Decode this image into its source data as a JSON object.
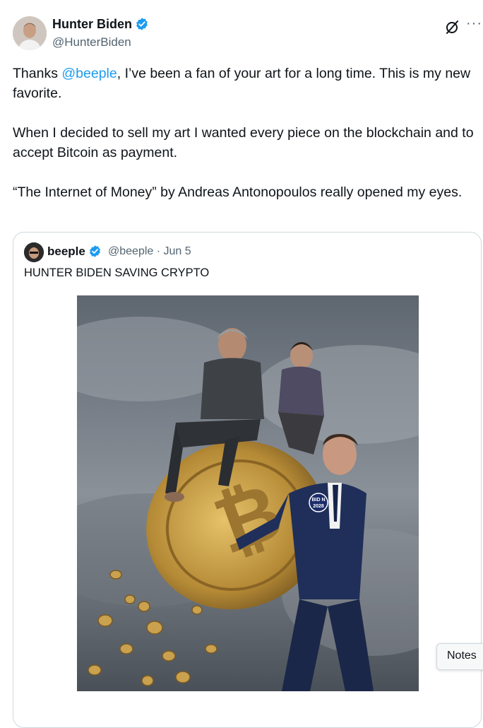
{
  "author": {
    "name": "Hunter Biden",
    "handle": "@HunterBiden"
  },
  "tweet": {
    "p1_before": "Thanks ",
    "p1_mention": "@beeple",
    "p1_after": ", I’ve been a fan of your art for a long time. This is my new favorite.",
    "p2": "When I decided to sell my art I wanted every piece on the blockchain and to accept Bitcoin as payment.",
    "p3": "“The Internet of Money” by Andreas Antonopoulos really opened my eyes."
  },
  "quoted": {
    "name": "beeple",
    "handle": "@beeple",
    "separator": "·",
    "date": "Jun 5",
    "text": "HUNTER BIDEN SAVING CRYPTO",
    "image_badge": [
      "BID N",
      "2028"
    ]
  },
  "icons": {
    "verified": "verified-badge-icon",
    "grok": "grok-icon",
    "more": "more-icon"
  },
  "more_label": "···",
  "notes_label": "Notes",
  "colors": {
    "accent": "#1d9bf0",
    "text": "#0f1419",
    "secondary": "#536471",
    "border": "#cfd9de"
  }
}
